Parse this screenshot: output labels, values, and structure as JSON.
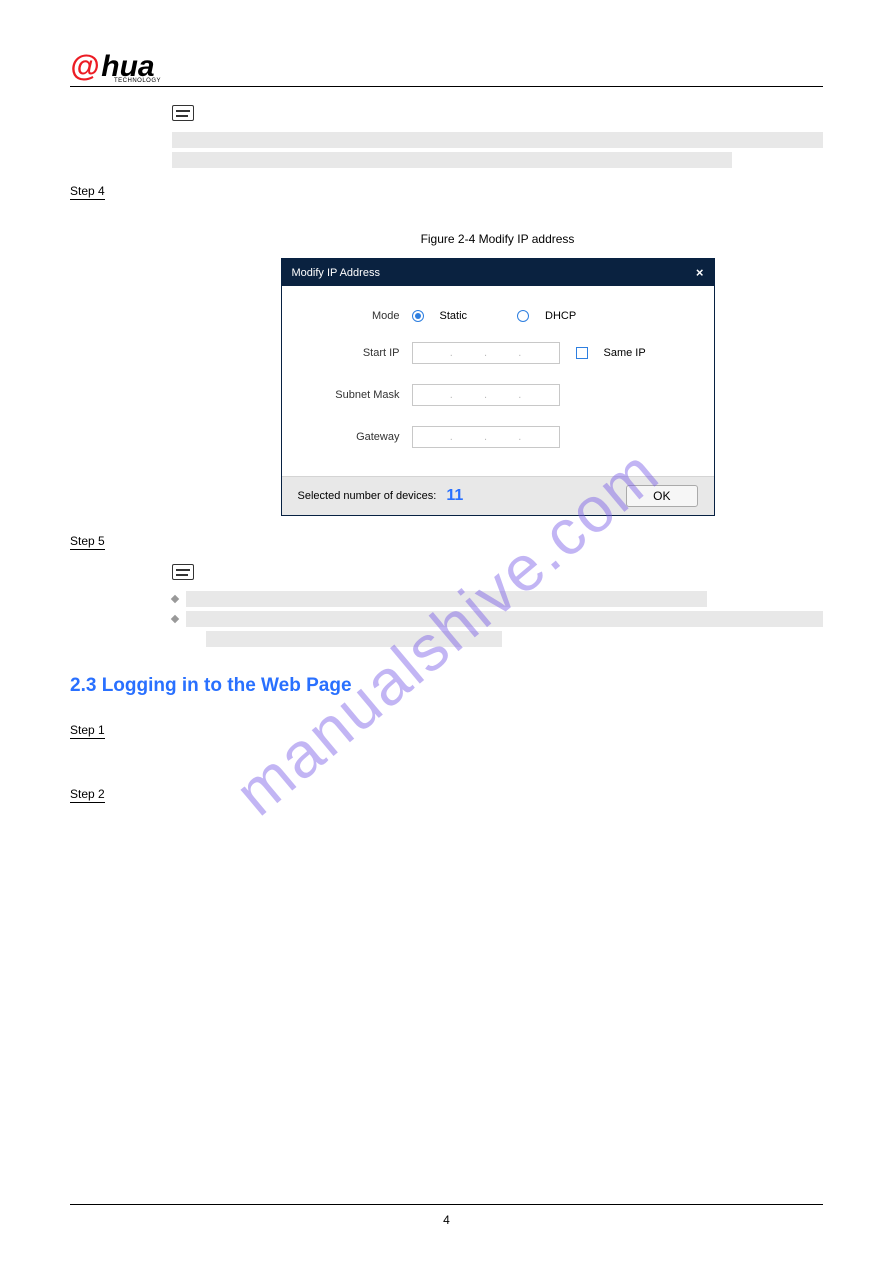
{
  "logo": {
    "left": "@",
    "right": "hua",
    "sub": "TECHNOLOGY"
  },
  "step4": {
    "label": "Step 4"
  },
  "figure_caption": "Figure 2-4 Modify IP address",
  "dialog": {
    "title": "Modify IP Address",
    "mode_label": "Mode",
    "static_label": "Static",
    "dhcp_label": "DHCP",
    "start_ip_label": "Start IP",
    "same_ip_label": "Same IP",
    "subnet_label": "Subnet Mask",
    "gateway_label": "Gateway",
    "footer_label": "Selected number of devices:",
    "device_count": "11",
    "ok": "OK"
  },
  "step5": {
    "label": "Step 5"
  },
  "section": {
    "num": "2.3",
    "title": "Logging in to the Web Page"
  },
  "step1": {
    "label": "Step 1"
  },
  "step2": {
    "label": "Step 2"
  },
  "watermark": "manualshive.com",
  "footer": "4",
  "chart_data": null
}
